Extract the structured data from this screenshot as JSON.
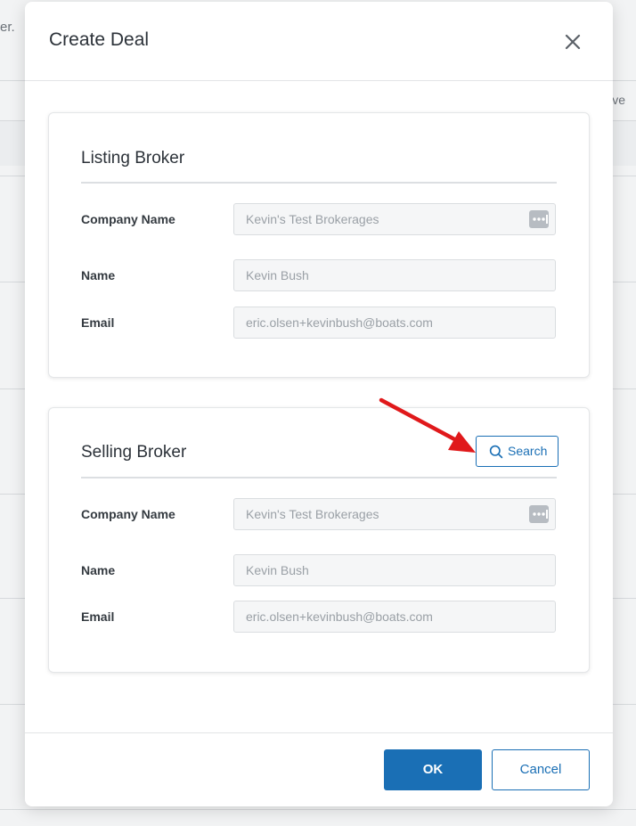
{
  "background": {
    "left_fragment": "er.",
    "right_fragment": "ve"
  },
  "modal": {
    "title": "Create Deal",
    "close_icon": "close-icon",
    "listing_broker": {
      "title": "Listing Broker",
      "fields": [
        {
          "label": "Company Name",
          "value": "Kevin's Test Brokerages",
          "has_more_button": true
        },
        {
          "label": "Name",
          "value": "Kevin Bush"
        },
        {
          "label": "Email",
          "value": "eric.olsen+kevinbush@boats.com"
        }
      ]
    },
    "selling_broker": {
      "title": "Selling Broker",
      "search_label": "Search",
      "search_icon": "search-icon",
      "fields": [
        {
          "label": "Company Name",
          "value": "Kevin's Test Brokerages",
          "has_more_button": true
        },
        {
          "label": "Name",
          "value": "Kevin Bush"
        },
        {
          "label": "Email",
          "value": "eric.olsen+kevinbush@boats.com"
        }
      ]
    },
    "footer": {
      "ok_label": "OK",
      "cancel_label": "Cancel"
    }
  },
  "colors": {
    "primary": "#1a6fb5",
    "annotation_arrow": "#e0191b"
  }
}
